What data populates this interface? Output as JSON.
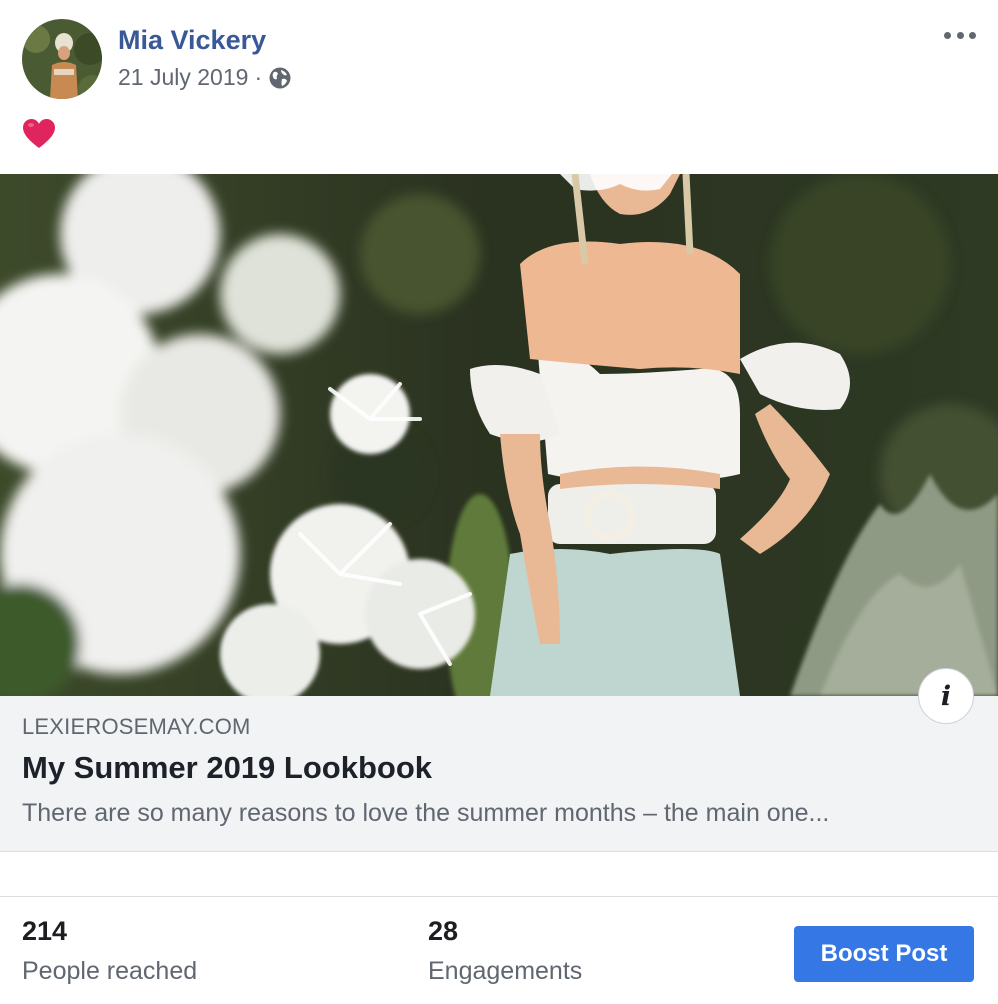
{
  "post": {
    "author": "Mia Vickery",
    "date": "21 July 2019",
    "separator": "·",
    "privacy_icon": "globe-icon",
    "menu_icon": "more-options-icon",
    "message_icon": "heart-icon"
  },
  "link_preview": {
    "domain": "LEXIEROSEMAY.COM",
    "title": "My Summer 2019 Lookbook",
    "description": "There are so many reasons to love the summer months – the main one...",
    "info_label": "i"
  },
  "insights": {
    "reach_value": "214",
    "reach_label": "People reached",
    "engagement_value": "28",
    "engagement_label": "Engagements"
  },
  "actions": {
    "boost_label": "Boost Post"
  },
  "colors": {
    "author_link": "#385898",
    "secondary_text": "#606770",
    "preview_bg": "#f2f3f5",
    "boost_button": "#3578e5",
    "heart": "#e0245e"
  }
}
